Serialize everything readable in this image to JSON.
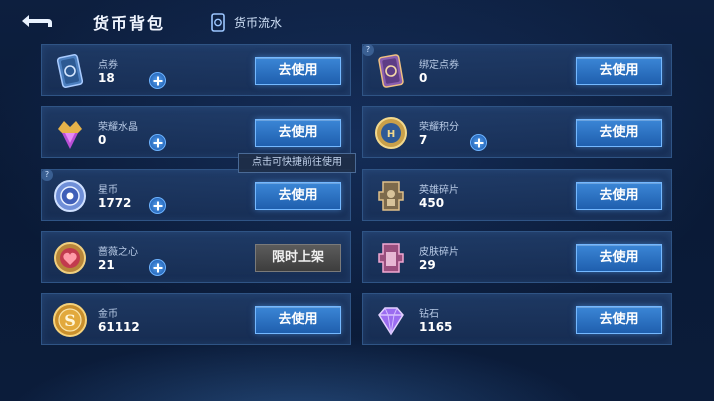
{
  "header": {
    "title": "货币背包",
    "flow_tab": "货币流水"
  },
  "action_label": "去使用",
  "limited_label": "限时上架",
  "tooltip": "点击可快捷前往使用",
  "colors": {
    "button_blue": "#2f77c8",
    "card_border": "#2f5485",
    "background": "#0b1c3a"
  },
  "currencies": [
    {
      "name": "点券",
      "count": "18",
      "icon": "coupon-card-icon"
    },
    {
      "name": "绑定点券",
      "count": "0",
      "icon": "bound-coupon-card-icon"
    },
    {
      "name": "荣耀水晶",
      "count": "0",
      "icon": "glory-crystal-icon"
    },
    {
      "name": "荣耀积分",
      "count": "7",
      "icon": "glory-points-medal-icon"
    },
    {
      "name": "星币",
      "count": "1772",
      "icon": "star-coin-icon"
    },
    {
      "name": "英雄碎片",
      "count": "450",
      "icon": "hero-fragment-icon"
    },
    {
      "name": "蔷薇之心",
      "count": "21",
      "icon": "rose-heart-icon"
    },
    {
      "name": "皮肤碎片",
      "count": "29",
      "icon": "skin-fragment-icon"
    },
    {
      "name": "金币",
      "count": "61112",
      "icon": "gold-coin-icon"
    },
    {
      "name": "钻石",
      "count": "1165",
      "icon": "diamond-icon"
    }
  ]
}
